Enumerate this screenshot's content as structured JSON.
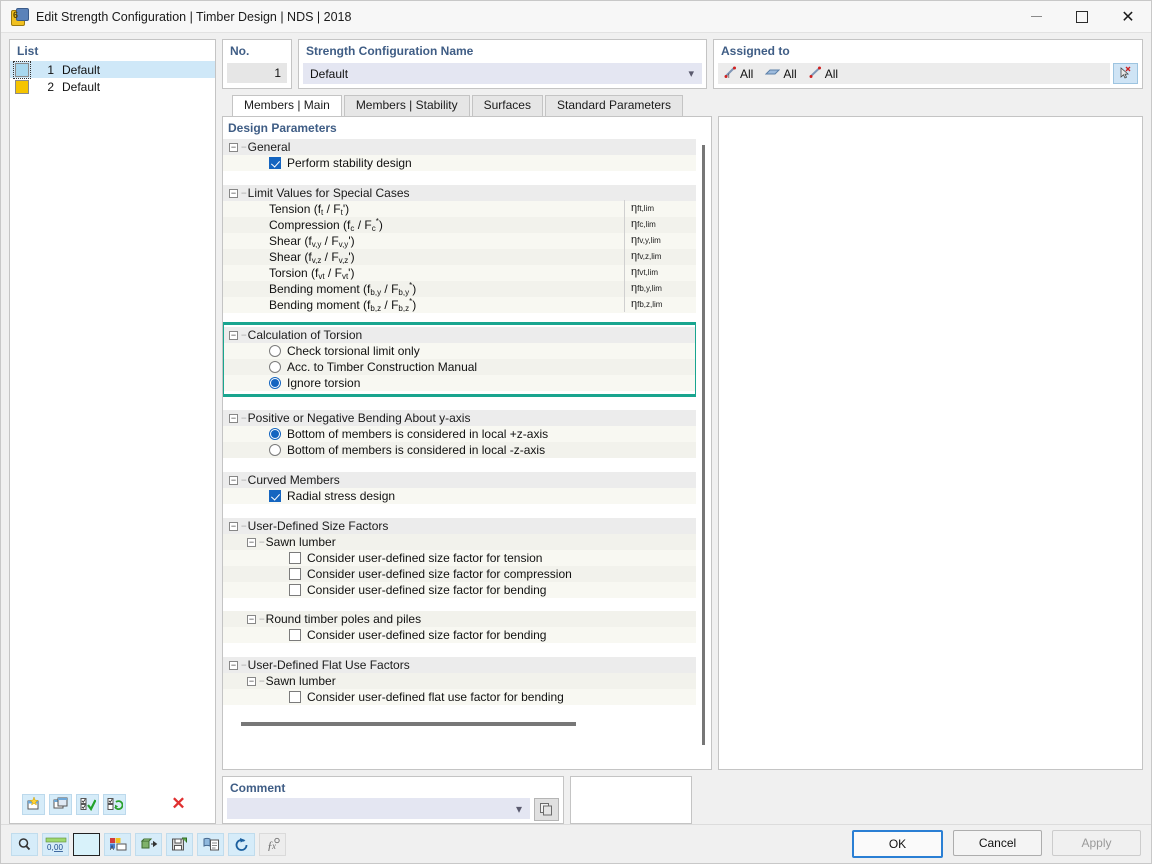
{
  "window": {
    "title": "Edit Strength Configuration | Timber Design | NDS | 2018",
    "minimize_label": "Minimize",
    "maximize_label": "Maximize",
    "close_label": "✕"
  },
  "list_panel": {
    "caption": "List",
    "rows": [
      {
        "index": "1",
        "label": "Default",
        "color": "#a8d8ef",
        "selected": true
      },
      {
        "index": "2",
        "label": "Default",
        "color": "#f5c400",
        "selected": false
      }
    ],
    "toolbar": [
      {
        "name": "new-configuration-button",
        "title": "New"
      },
      {
        "name": "copy-configuration-button",
        "title": "Copy"
      },
      {
        "name": "select-all-button",
        "title": "Select All"
      },
      {
        "name": "invert-selection-button",
        "title": "Invert Selection"
      },
      {
        "name": "delete-configuration-button",
        "title": "Delete",
        "glyph": "✕"
      }
    ]
  },
  "no_field": {
    "caption": "No.",
    "value": "1"
  },
  "name_field": {
    "caption": "Strength Configuration Name",
    "value": "Default"
  },
  "assigned_to": {
    "caption": "Assigned to",
    "items": [
      {
        "icon": "member-dimension-icon",
        "label": "All"
      },
      {
        "icon": "surface-icon",
        "label": "All"
      },
      {
        "icon": "member-icon",
        "label": "All"
      }
    ],
    "select_button": "pick-objects-button"
  },
  "tabs": [
    {
      "label": "Members | Main",
      "active": true
    },
    {
      "label": "Members | Stability",
      "active": false
    },
    {
      "label": "Surfaces",
      "active": false
    },
    {
      "label": "Standard Parameters",
      "active": false
    }
  ],
  "design_parameters": {
    "caption": "Design Parameters",
    "general": {
      "title": "General",
      "items": [
        {
          "label": "Perform stability design",
          "checked": true
        }
      ]
    },
    "limit_values": {
      "title": "Limit Values for Special Cases",
      "rows": [
        {
          "label_pre": "Tension (f",
          "sub1": "t",
          "label_mid": " / F",
          "sub2": "t",
          "label_post": "')",
          "eta_sub": "ft,lim"
        },
        {
          "label_pre": "Compression (f",
          "sub1": "c",
          "label_mid": " / F",
          "sub2": "c",
          "sup2": "*",
          "label_post": ")",
          "eta_sub": "fc,lim"
        },
        {
          "label_pre": "Shear (f",
          "sub1": "v,y",
          "label_mid": " / F",
          "sub2": "v,y",
          "label_post": "')",
          "eta_sub": "fv,y,lim"
        },
        {
          "label_pre": "Shear (f",
          "sub1": "v,z",
          "label_mid": " / F",
          "sub2": "v,z",
          "label_post": "')",
          "eta_sub": "fv,z,lim"
        },
        {
          "label_pre": "Torsion (f",
          "sub1": "vt",
          "label_mid": " / F",
          "sub2": "vt",
          "label_post": "')",
          "eta_sub": "fvt,lim"
        },
        {
          "label_pre": "Bending moment (f",
          "sub1": "b,y",
          "label_mid": " / F",
          "sub2": "b,y",
          "sup2": "*",
          "label_post": ")",
          "eta_sub": "fb,y,lim"
        },
        {
          "label_pre": "Bending moment (f",
          "sub1": "b,z",
          "label_mid": " / F",
          "sub2": "b,z",
          "sup2": "*",
          "label_post": ")",
          "eta_sub": "fb,z,lim"
        }
      ]
    },
    "calculation_of_torsion": {
      "title": "Calculation of Torsion",
      "highlighted": true,
      "highlight_color": "#19a58f",
      "options": [
        {
          "label": "Check torsional limit only",
          "selected": false
        },
        {
          "label": "Acc. to Timber Construction Manual",
          "selected": false
        },
        {
          "label": "Ignore torsion",
          "selected": true
        }
      ]
    },
    "bending_about_y": {
      "title": "Positive or Negative Bending About y-axis",
      "options": [
        {
          "label": "Bottom of members is considered in local +z-axis",
          "selected": true
        },
        {
          "label": "Bottom of members is considered in local -z-axis",
          "selected": false
        }
      ]
    },
    "curved_members": {
      "title": "Curved Members",
      "items": [
        {
          "label": "Radial stress design",
          "checked": true
        }
      ]
    },
    "size_factors": {
      "title": "User-Defined Size Factors",
      "groups": [
        {
          "title": "Sawn lumber",
          "items": [
            {
              "label": "Consider user-defined size factor for tension",
              "checked": false
            },
            {
              "label": "Consider user-defined size factor for compression",
              "checked": false
            },
            {
              "label": "Consider user-defined size factor for bending",
              "checked": false
            }
          ]
        },
        {
          "title": "Round timber poles and piles",
          "items": [
            {
              "label": "Consider user-defined size factor for bending",
              "checked": false
            }
          ]
        }
      ]
    },
    "flat_use_factors": {
      "title": "User-Defined Flat Use Factors",
      "groups": [
        {
          "title": "Sawn lumber",
          "items": [
            {
              "label": "Consider user-defined flat use factor for bending",
              "checked": false
            }
          ]
        }
      ]
    }
  },
  "comment": {
    "caption": "Comment",
    "value": "",
    "placeholder": ""
  },
  "footer": {
    "toolbar": [
      {
        "name": "search-magnifier-button"
      },
      {
        "name": "units-decimals-button",
        "label": "0,00"
      },
      {
        "name": "color-swatch-button"
      },
      {
        "name": "display-properties-button"
      },
      {
        "name": "export-button"
      },
      {
        "name": "save-button"
      },
      {
        "name": "report-button"
      },
      {
        "name": "reset-defaults-button"
      },
      {
        "name": "formula-button",
        "label": "ƒx"
      }
    ],
    "buttons": [
      {
        "label": "OK",
        "state": "default"
      },
      {
        "label": "Cancel",
        "state": "normal"
      },
      {
        "label": "Apply",
        "state": "disabled"
      }
    ]
  }
}
